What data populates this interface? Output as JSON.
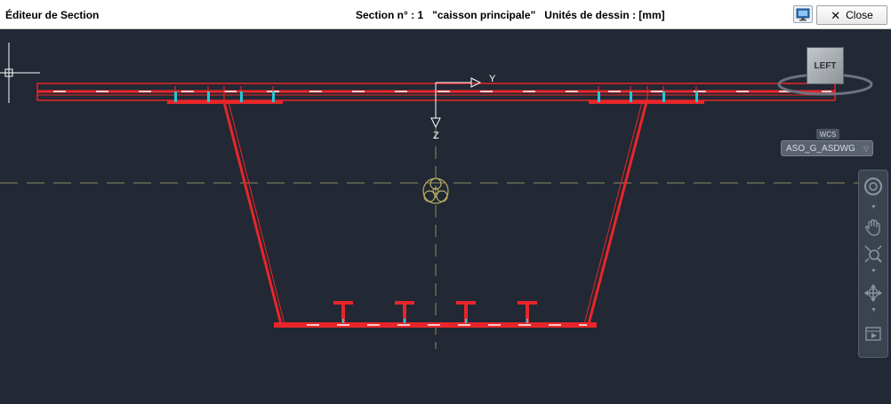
{
  "window": {
    "title": "Éditeur de Section",
    "section_label": "Section n° : 1",
    "section_name": "\"caisson principale\"",
    "units_label": "Unités de dessin : [mm]",
    "close_label": "Close"
  },
  "viewport": {
    "background_color": "#222834",
    "axis_y_label": "Y",
    "axis_z_label": "Z",
    "viewcube_label": "LEFT",
    "wcs_label": "WCS",
    "ucs_name": "ASO_G_ASDWG"
  },
  "navbar": {
    "tools": [
      "steering-wheel-icon",
      "pan-hand-icon",
      "zoom-extents-icon",
      "orbit-icon",
      "showmotion-icon"
    ]
  },
  "colors": {
    "section_outline": "#e8262a",
    "centerline": "#8e8e62",
    "stiffener_marker": "#26c6d8",
    "axis": "#ffffff"
  }
}
